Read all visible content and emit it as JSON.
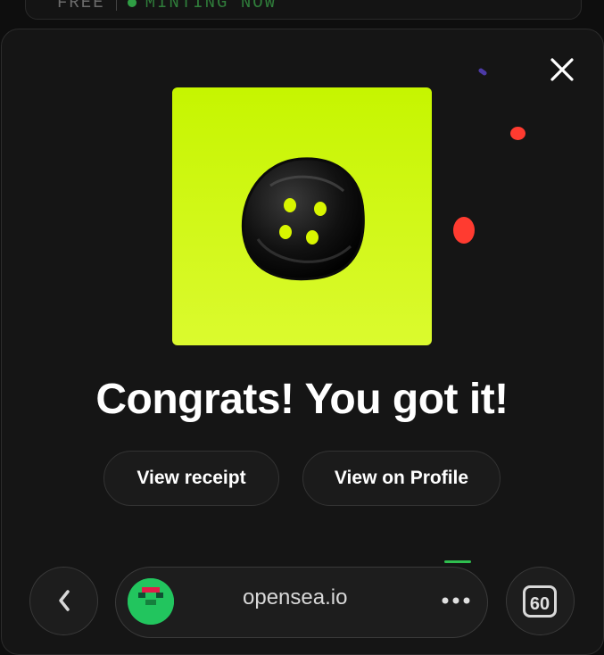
{
  "background_card": {
    "price": "FREE",
    "status": "MINTING NOW"
  },
  "modal": {
    "close_icon": "close-icon",
    "title": "Congrats! You got it!",
    "buttons": {
      "view_receipt": "View receipt",
      "view_on_profile": "View on Profile"
    }
  },
  "browser_bar": {
    "url": "opensea.io",
    "tab_count": "60",
    "back_icon": "chevron-left-icon",
    "more_icon": "more-horizontal-icon"
  },
  "colors": {
    "art_background": "#c6f500",
    "button_dark": "#111111",
    "confetti_red": "#ff3b30",
    "confetti_purple": "#4c3aa6",
    "status_green": "#2f9e44"
  }
}
